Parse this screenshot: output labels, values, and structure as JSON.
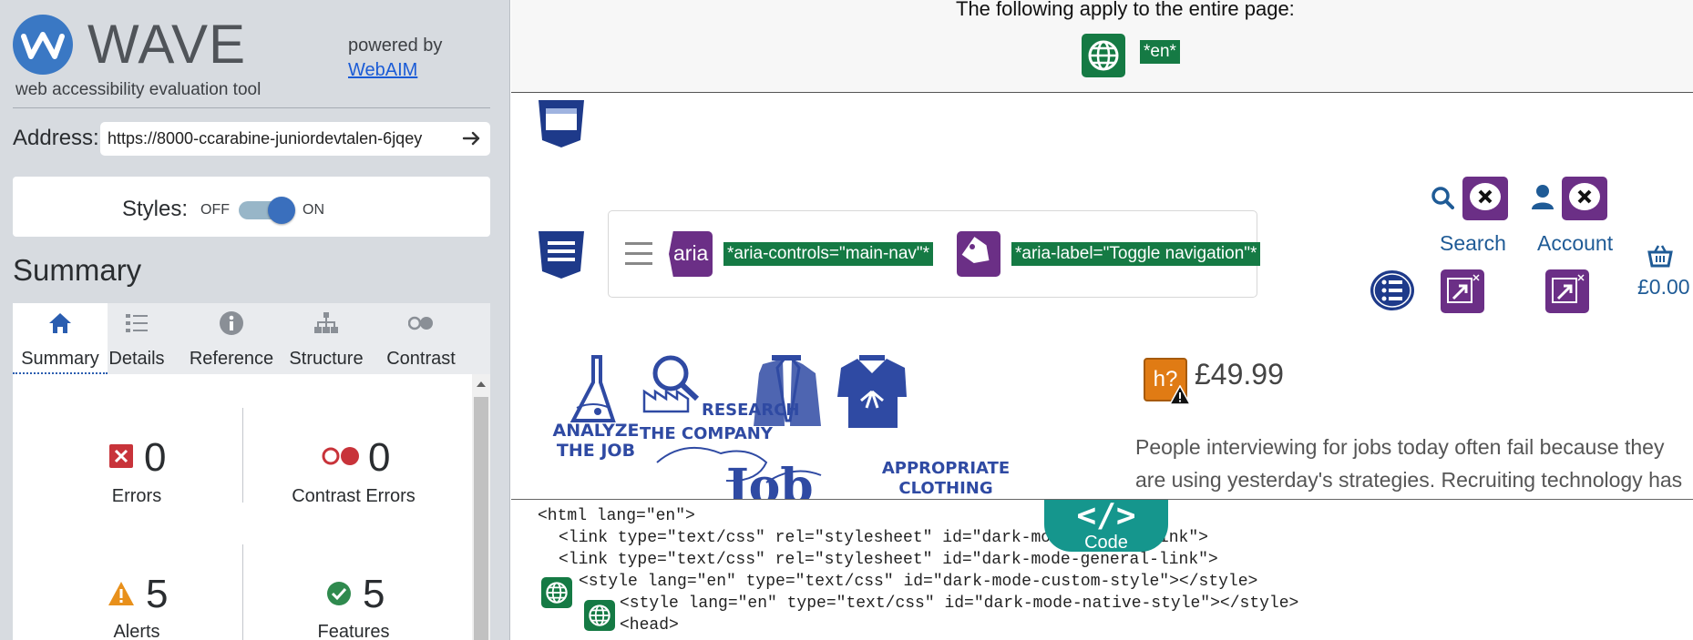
{
  "sidebar": {
    "logo_text": "WAVE",
    "logo_subtitle": "web accessibility evaluation tool",
    "powered_by": "powered by",
    "webaim_link": "WebAIM",
    "address_label": "Address:",
    "address_value": "https://8000-ccarabine-juniordevtalen-6jqey",
    "styles_label": "Styles:",
    "styles_off": "OFF",
    "styles_on": "ON",
    "styles_state": "on",
    "summary_heading": "Summary",
    "tabs": [
      {
        "label": "Summary",
        "icon": "home-icon",
        "active": true
      },
      {
        "label": "Details",
        "icon": "list-icon",
        "active": false
      },
      {
        "label": "Reference",
        "icon": "info-icon",
        "active": false
      },
      {
        "label": "Structure",
        "icon": "sitemap-icon",
        "active": false
      },
      {
        "label": "Contrast",
        "icon": "contrast-icon",
        "active": false
      }
    ],
    "counts": {
      "errors": {
        "value": "0",
        "label": "Errors",
        "color": "#c8333a"
      },
      "contrast_errors": {
        "value": "0",
        "label": "Contrast Errors",
        "color": "#c8333a"
      },
      "alerts": {
        "value": "5",
        "label": "Alerts",
        "color": "#e8901b"
      },
      "features": {
        "value": "5",
        "label": "Features",
        "color": "#2f8a4e"
      }
    }
  },
  "preview": {
    "applies_text": "The following apply to the entire page:",
    "lang_badge": "*en*",
    "aria_icon_text": "aria",
    "aria_controls": "*aria-controls=\"main-nav\"*",
    "aria_label": "*aria-label=\"Toggle navigation\"*",
    "search_label": "Search",
    "account_label": "Account",
    "cart_price": "£0.00",
    "h_icon_text": "h?",
    "product_price": "£49.99",
    "description": "People interviewing for jobs today often fail because they are using yesterday's strategies. Recruiting technology has",
    "sketch_labels": [
      "ANALYZE",
      "THE JOB",
      "RESEARCH",
      "THE COMPANY",
      "APPROPRIATE",
      "CLOTHING",
      "Job"
    ],
    "colors": {
      "feature_green": "#157a44",
      "aria_purple": "#6b2f86",
      "structure_navy": "#1e3a8a",
      "alert_orange": "#e07b14",
      "link_blue": "#1f5b96"
    }
  },
  "code": {
    "tab_label": "Code",
    "tab_symbol": "</>",
    "lines": [
      "<html lang=\"en\">",
      "<link type=\"text/css\" rel=\"stylesheet\" id=\"dark-mode-custom-link\">",
      "<link type=\"text/css\" rel=\"stylesheet\" id=\"dark-mode-general-link\">",
      "<style lang=\"en\" type=\"text/css\" id=\"dark-mode-custom-style\"></style>",
      "<style lang=\"en\" type=\"text/css\" id=\"dark-mode-native-style\"></style>",
      "<head>"
    ]
  }
}
